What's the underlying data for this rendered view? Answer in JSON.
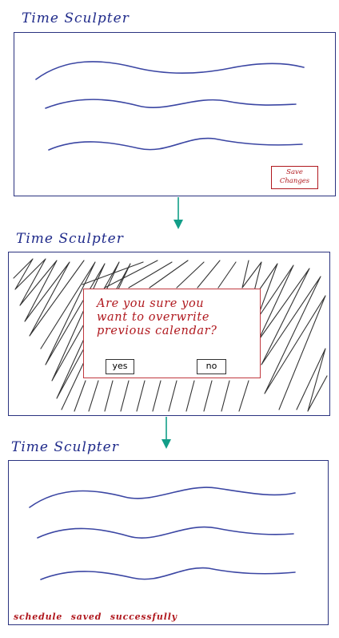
{
  "app_title": "Time Sculpter",
  "colors": {
    "title": "#1f2a8a",
    "frame_border": "#2b3380",
    "wave": "#3b46a3",
    "accent_red": "#b0181e",
    "arrow": "#129e88",
    "scribble": "#333333"
  },
  "screen1": {
    "title": "Time Sculpter",
    "save_button": {
      "line1": "Save",
      "line2": "Changes"
    }
  },
  "screen2": {
    "title": "Time Sculpter",
    "dialog": {
      "line1": "Are you sure you",
      "line2": "want to overwrite",
      "line3": "previous calendar?",
      "yes_label": "yes",
      "no_label": "no"
    }
  },
  "screen3": {
    "title": "Time Sculpter",
    "status_message": "schedule saved successfully"
  }
}
